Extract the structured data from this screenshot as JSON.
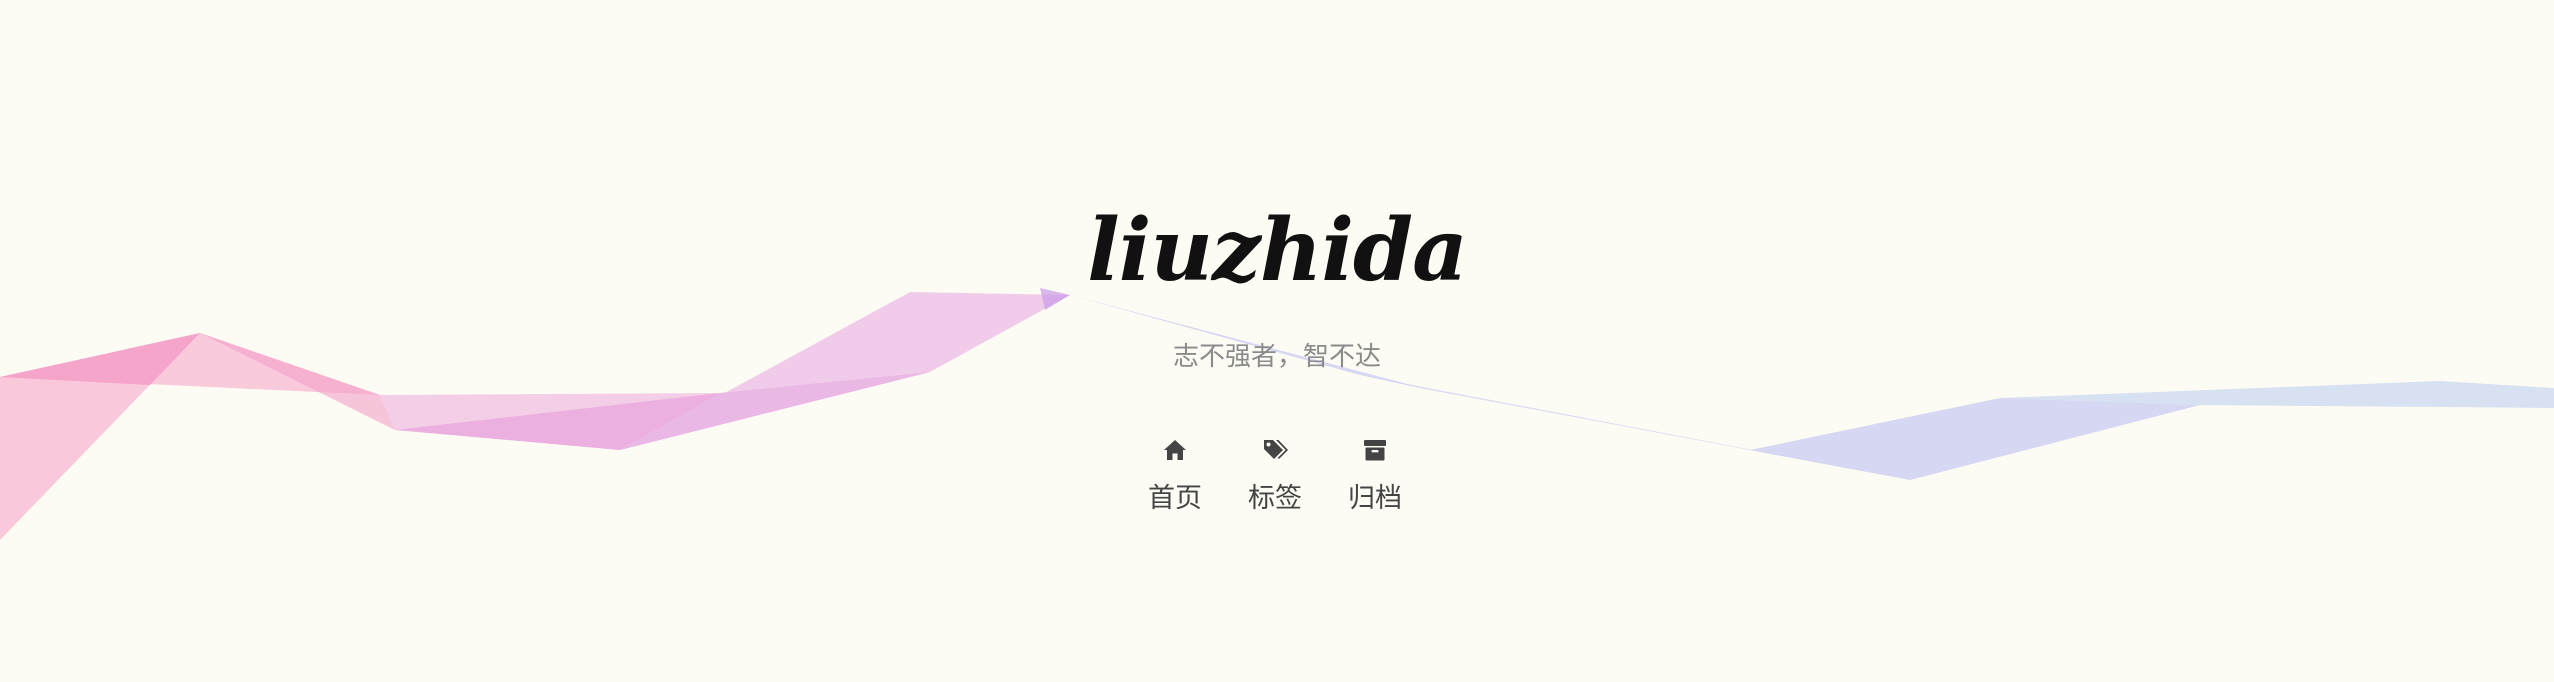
{
  "site": {
    "title": "liuzhida",
    "subtitle": "志不强者，智不达"
  },
  "nav": {
    "items": [
      {
        "label": "首页",
        "icon": "home-icon"
      },
      {
        "label": "标签",
        "icon": "tags-icon"
      },
      {
        "label": "归档",
        "icon": "archive-icon"
      }
    ]
  },
  "colors": {
    "background": "#fdfcf4",
    "title": "#111111",
    "subtitle": "#8a8a8a",
    "nav_text": "#444444",
    "ribbon_pink": "#f06fb0",
    "ribbon_purple": "#d98be0",
    "ribbon_blue": "#b9c3f0"
  }
}
